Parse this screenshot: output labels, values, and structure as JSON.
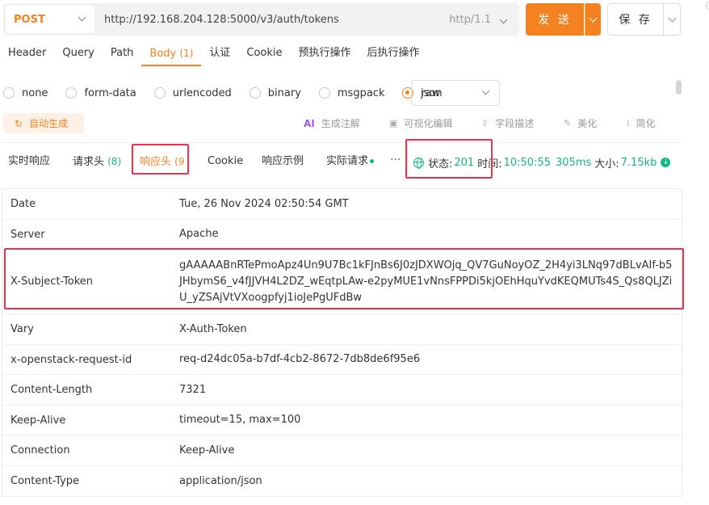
{
  "request": {
    "method": "POST",
    "url": "http://192.168.204.128:5000/v3/auth/tokens",
    "protocol": "http/1.1",
    "send_label": "发 送",
    "save_label": "保 存"
  },
  "request_tabs": [
    {
      "label": "Header",
      "count": ""
    },
    {
      "label": "Query",
      "count": ""
    },
    {
      "label": "Path",
      "count": ""
    },
    {
      "label": "Body",
      "count": "(1)"
    },
    {
      "label": "认证",
      "count": ""
    },
    {
      "label": "Cookie",
      "count": ""
    },
    {
      "label": "预执行操作",
      "count": ""
    },
    {
      "label": "后执行操作",
      "count": ""
    }
  ],
  "body_types": [
    "none",
    "form-data",
    "urlencoded",
    "binary",
    "msgpack",
    "raw"
  ],
  "body_selected": "raw",
  "body_format": "json",
  "toolbar": {
    "autogen": "自动生成",
    "gen_comment": "生成注解",
    "visual_edit": "可视化编辑",
    "field_desc": "字段描述",
    "beautify": "美化",
    "simplify": "简化"
  },
  "response_tabs": [
    {
      "label": "实时响应",
      "count": ""
    },
    {
      "label": "请求头",
      "count": "(8)"
    },
    {
      "label": "响应头",
      "count": "(9"
    },
    {
      "label": "Cookie",
      "count": ""
    },
    {
      "label": "响应示例",
      "count": ""
    },
    {
      "label": "实际请求",
      "count": ""
    }
  ],
  "more_label": "···",
  "status": {
    "status_label": "状态:",
    "status_value": "201",
    "time_label": "时间:",
    "time_value": "10:50:55",
    "duration": "305ms",
    "size_label": "大小:",
    "size_value": "7.15kb"
  },
  "headers": [
    {
      "key": "Date",
      "value": "Tue, 26 Nov 2024 02:50:54 GMT"
    },
    {
      "key": "Server",
      "value": "Apache"
    },
    {
      "key": "X-Subject-Token",
      "value": "gAAAAABnRTePmoApz4Un9U7Bc1kFJnBs6J0zJDXWOjq_QV7GuNoyOZ_2H4yi3LNq97dBLvAIf-b5JHbymS6_v4fJJVH4L2DZ_wEqtpLAw-e2pyMUE1vNnsFPPDi5kjOEhHquYvdKEQMUTs4S_Qs8QLJZiU_yZSAjVtVXoogpfyj1ioJePgUFdBw"
    },
    {
      "key": "Vary",
      "value": "X-Auth-Token"
    },
    {
      "key": "x-openstack-request-id",
      "value": "req-d24dc05a-b7df-4cb2-8672-7db8de6f95e6"
    },
    {
      "key": "Content-Length",
      "value": "7321"
    },
    {
      "key": "Keep-Alive",
      "value": "timeout=15, max=100"
    },
    {
      "key": "Connection",
      "value": "Keep-Alive"
    },
    {
      "key": "Content-Type",
      "value": "application/json"
    }
  ]
}
